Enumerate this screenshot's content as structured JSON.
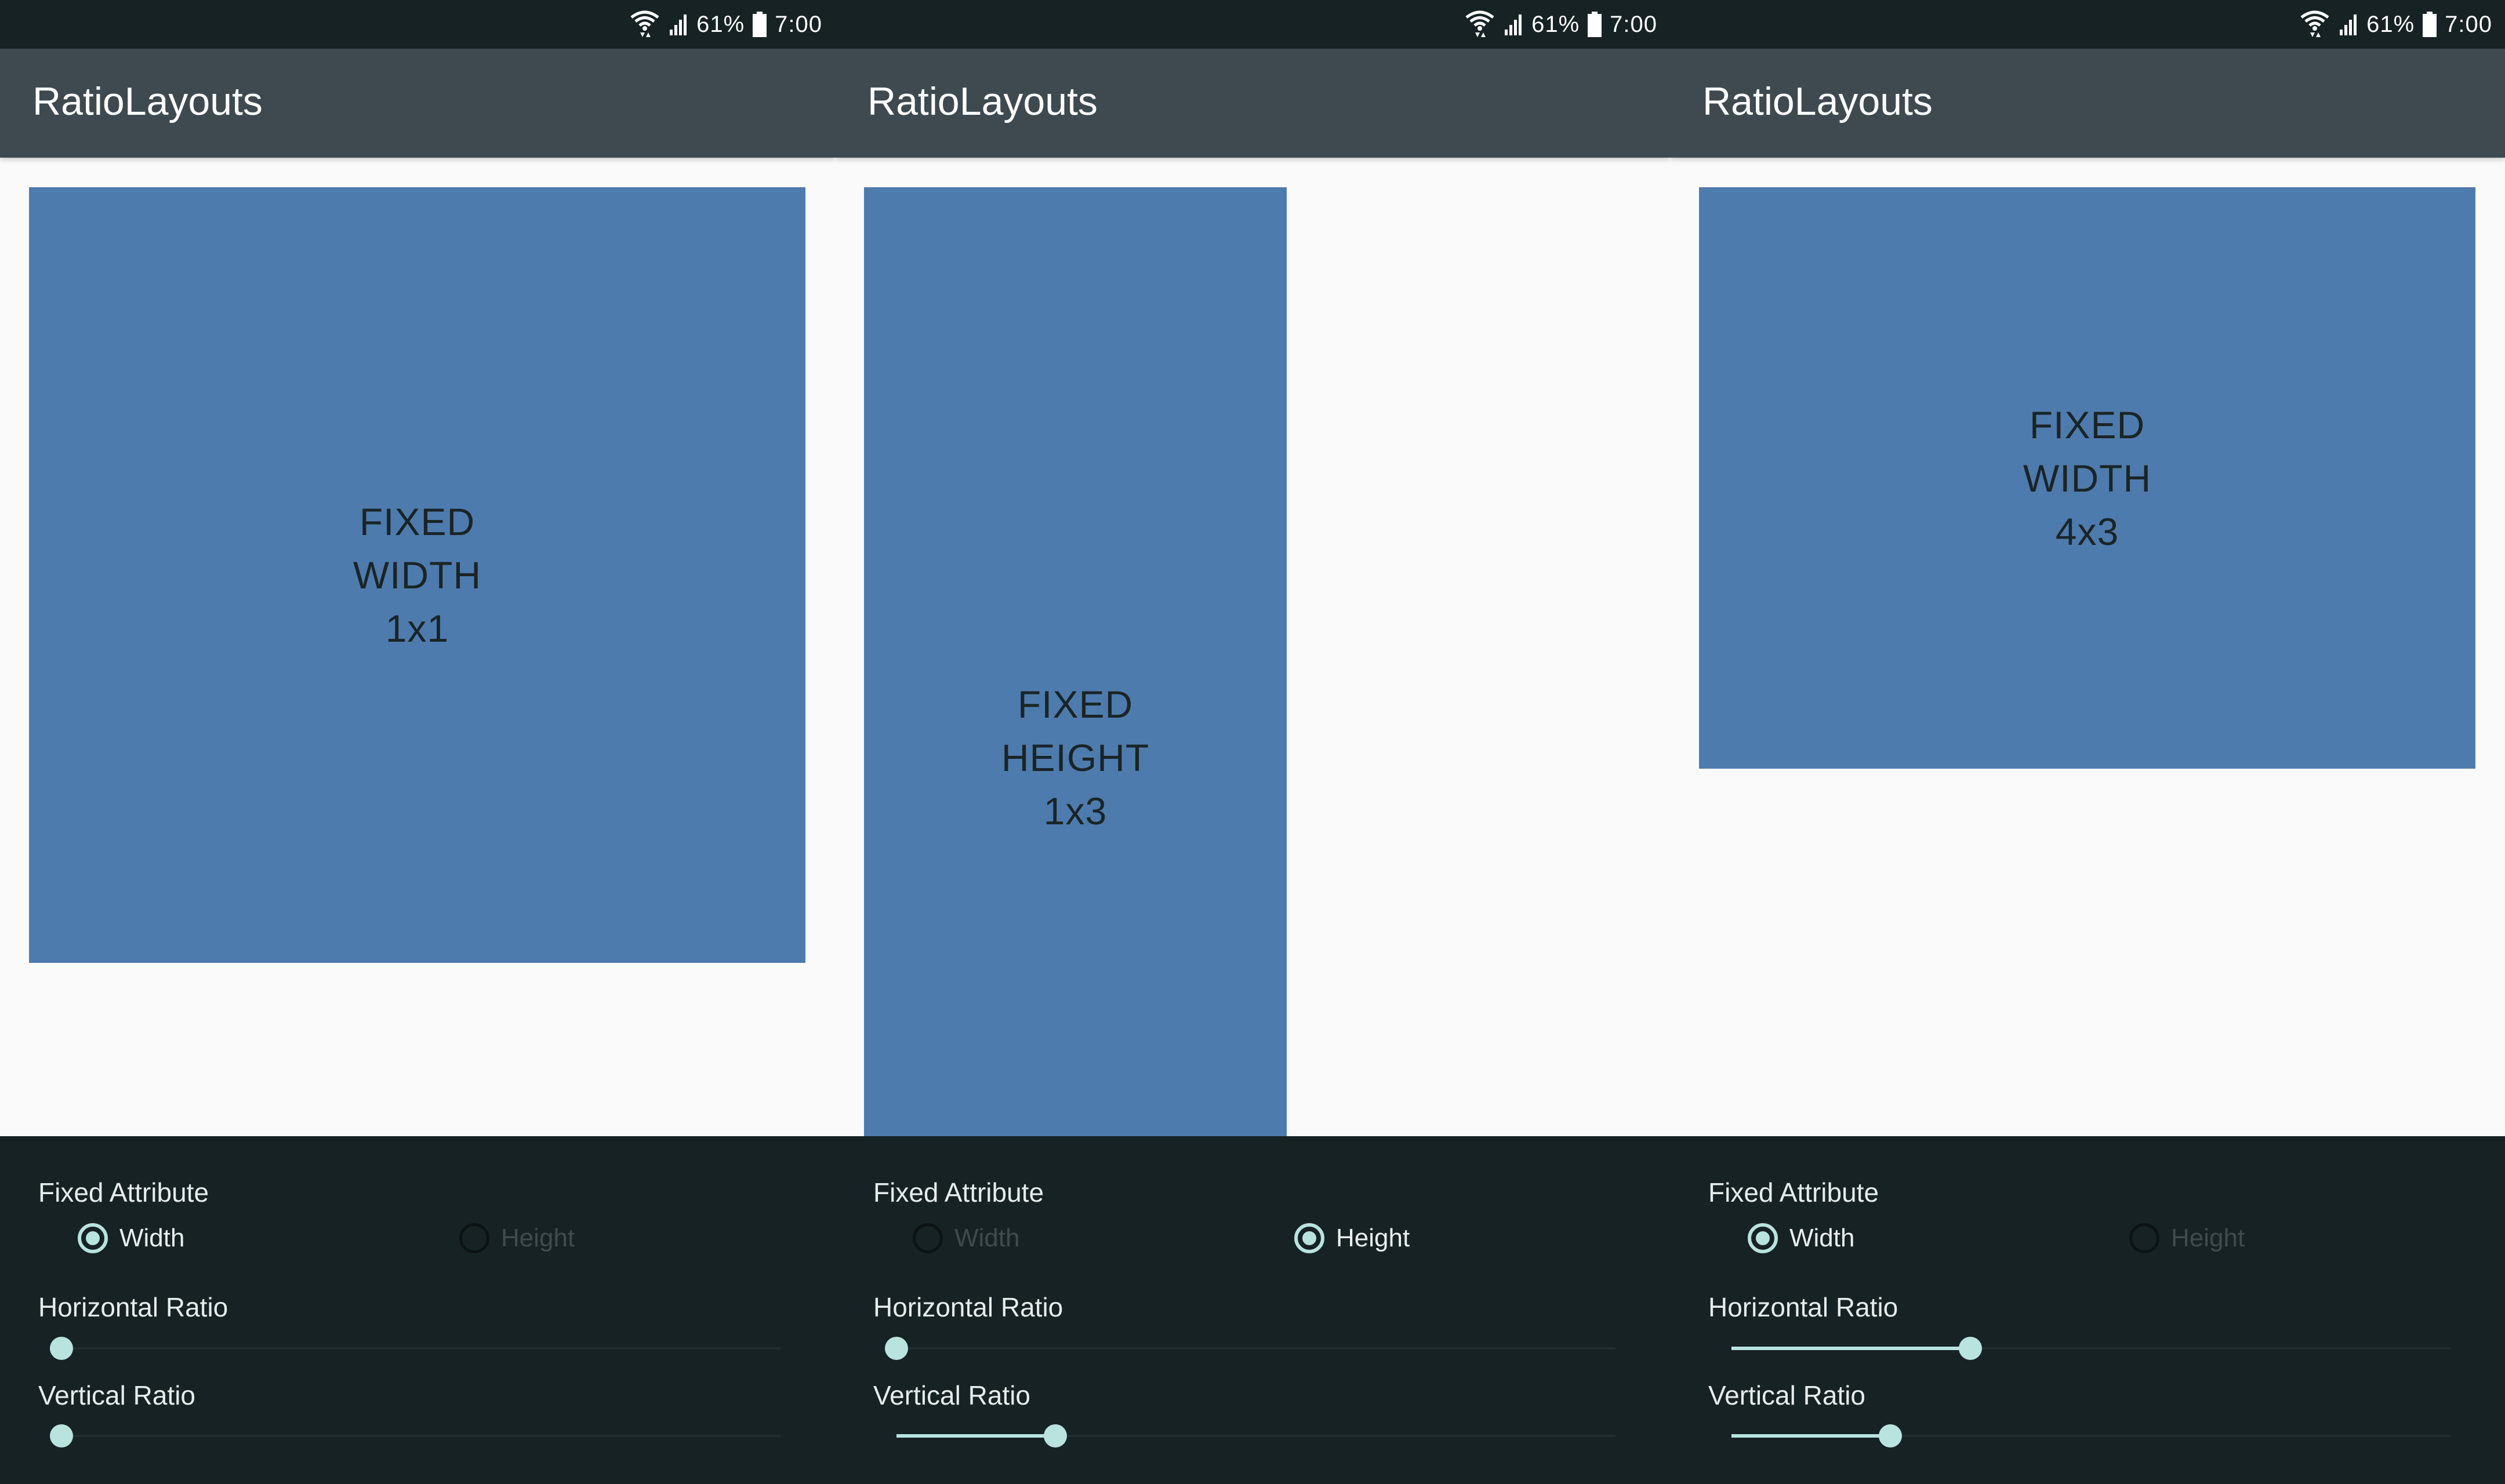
{
  "status": {
    "battery": "61%",
    "time": "7:00"
  },
  "app": {
    "title": "RatioLayouts"
  },
  "controls_labels": {
    "fixed_attribute": "Fixed Attribute",
    "width": "Width",
    "height": "Height",
    "horizontal_ratio": "Horizontal Ratio",
    "vertical_ratio": "Vertical Ratio"
  },
  "screens": [
    {
      "box_label": [
        "FIXED",
        "WIDTH",
        "1x1"
      ],
      "fixed": "width",
      "horizontal_ratio": 1,
      "vertical_ratio": 1
    },
    {
      "box_label": [
        "FIXED",
        "HEIGHT",
        "1x3"
      ],
      "fixed": "height",
      "horizontal_ratio": 1,
      "vertical_ratio": 3
    },
    {
      "box_label": [
        "FIXED",
        "WIDTH",
        "4x3"
      ],
      "fixed": "width",
      "horizontal_ratio": 4,
      "vertical_ratio": 3
    }
  ],
  "colors": {
    "status_bar": "#172224",
    "app_bar": "#3e4a4f",
    "content_bg": "#fafafa",
    "box": "#4e7bad",
    "box_text": "#1b2426",
    "controls_bg": "#172224",
    "accent": "#b8e3de"
  },
  "icons": [
    "wifi-icon",
    "signal-icon",
    "battery-icon"
  ]
}
